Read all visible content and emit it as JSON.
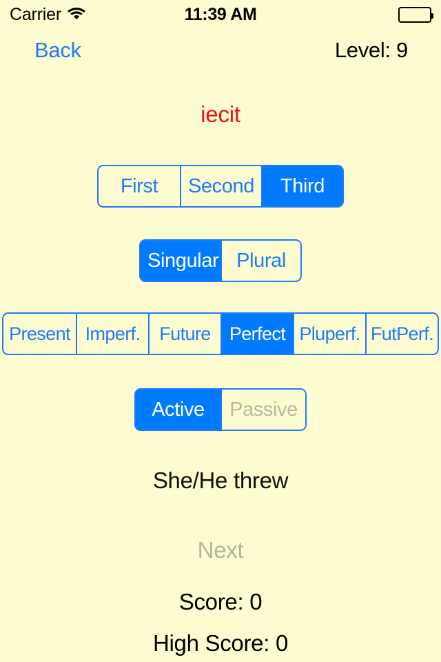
{
  "status_bar": {
    "carrier": "Carrier",
    "wifi_icon": "wifi-icon",
    "time": "11:39 AM",
    "battery_icon": "battery-full-icon"
  },
  "nav": {
    "back_label": "Back",
    "level_label": "Level: 9"
  },
  "quiz": {
    "prompt_word": "iecit",
    "translation": "She/He threw",
    "next_label": "Next",
    "next_enabled": false
  },
  "person_control": {
    "name": "person-segmented-control",
    "segments": [
      {
        "label": "First",
        "selected": false,
        "enabled": true
      },
      {
        "label": "Second",
        "selected": false,
        "enabled": true
      },
      {
        "label": "Third",
        "selected": true,
        "enabled": true
      }
    ]
  },
  "number_control": {
    "name": "number-segmented-control",
    "segments": [
      {
        "label": "Singular",
        "selected": true,
        "enabled": true
      },
      {
        "label": "Plural",
        "selected": false,
        "enabled": true
      }
    ]
  },
  "tense_control": {
    "name": "tense-segmented-control",
    "segments": [
      {
        "label": "Present",
        "selected": false,
        "enabled": true
      },
      {
        "label": "Imperf.",
        "selected": false,
        "enabled": true
      },
      {
        "label": "Future",
        "selected": false,
        "enabled": true
      },
      {
        "label": "Perfect",
        "selected": true,
        "enabled": true
      },
      {
        "label": "Pluperf.",
        "selected": false,
        "enabled": true
      },
      {
        "label": "FutPerf.",
        "selected": false,
        "enabled": true
      }
    ]
  },
  "voice_control": {
    "name": "voice-segmented-control",
    "segments": [
      {
        "label": "Active",
        "selected": true,
        "enabled": true
      },
      {
        "label": "Passive",
        "selected": false,
        "enabled": false
      }
    ]
  },
  "scores": {
    "score_label": "Score: 0",
    "high_score_label": "High Score: 0"
  },
  "colors": {
    "background": "#fcfcd0",
    "accent_blue": "#007aff",
    "link_blue": "#1f7bf7",
    "prompt_red": "#e4161e",
    "disabled_gray": "#b5b59c"
  }
}
